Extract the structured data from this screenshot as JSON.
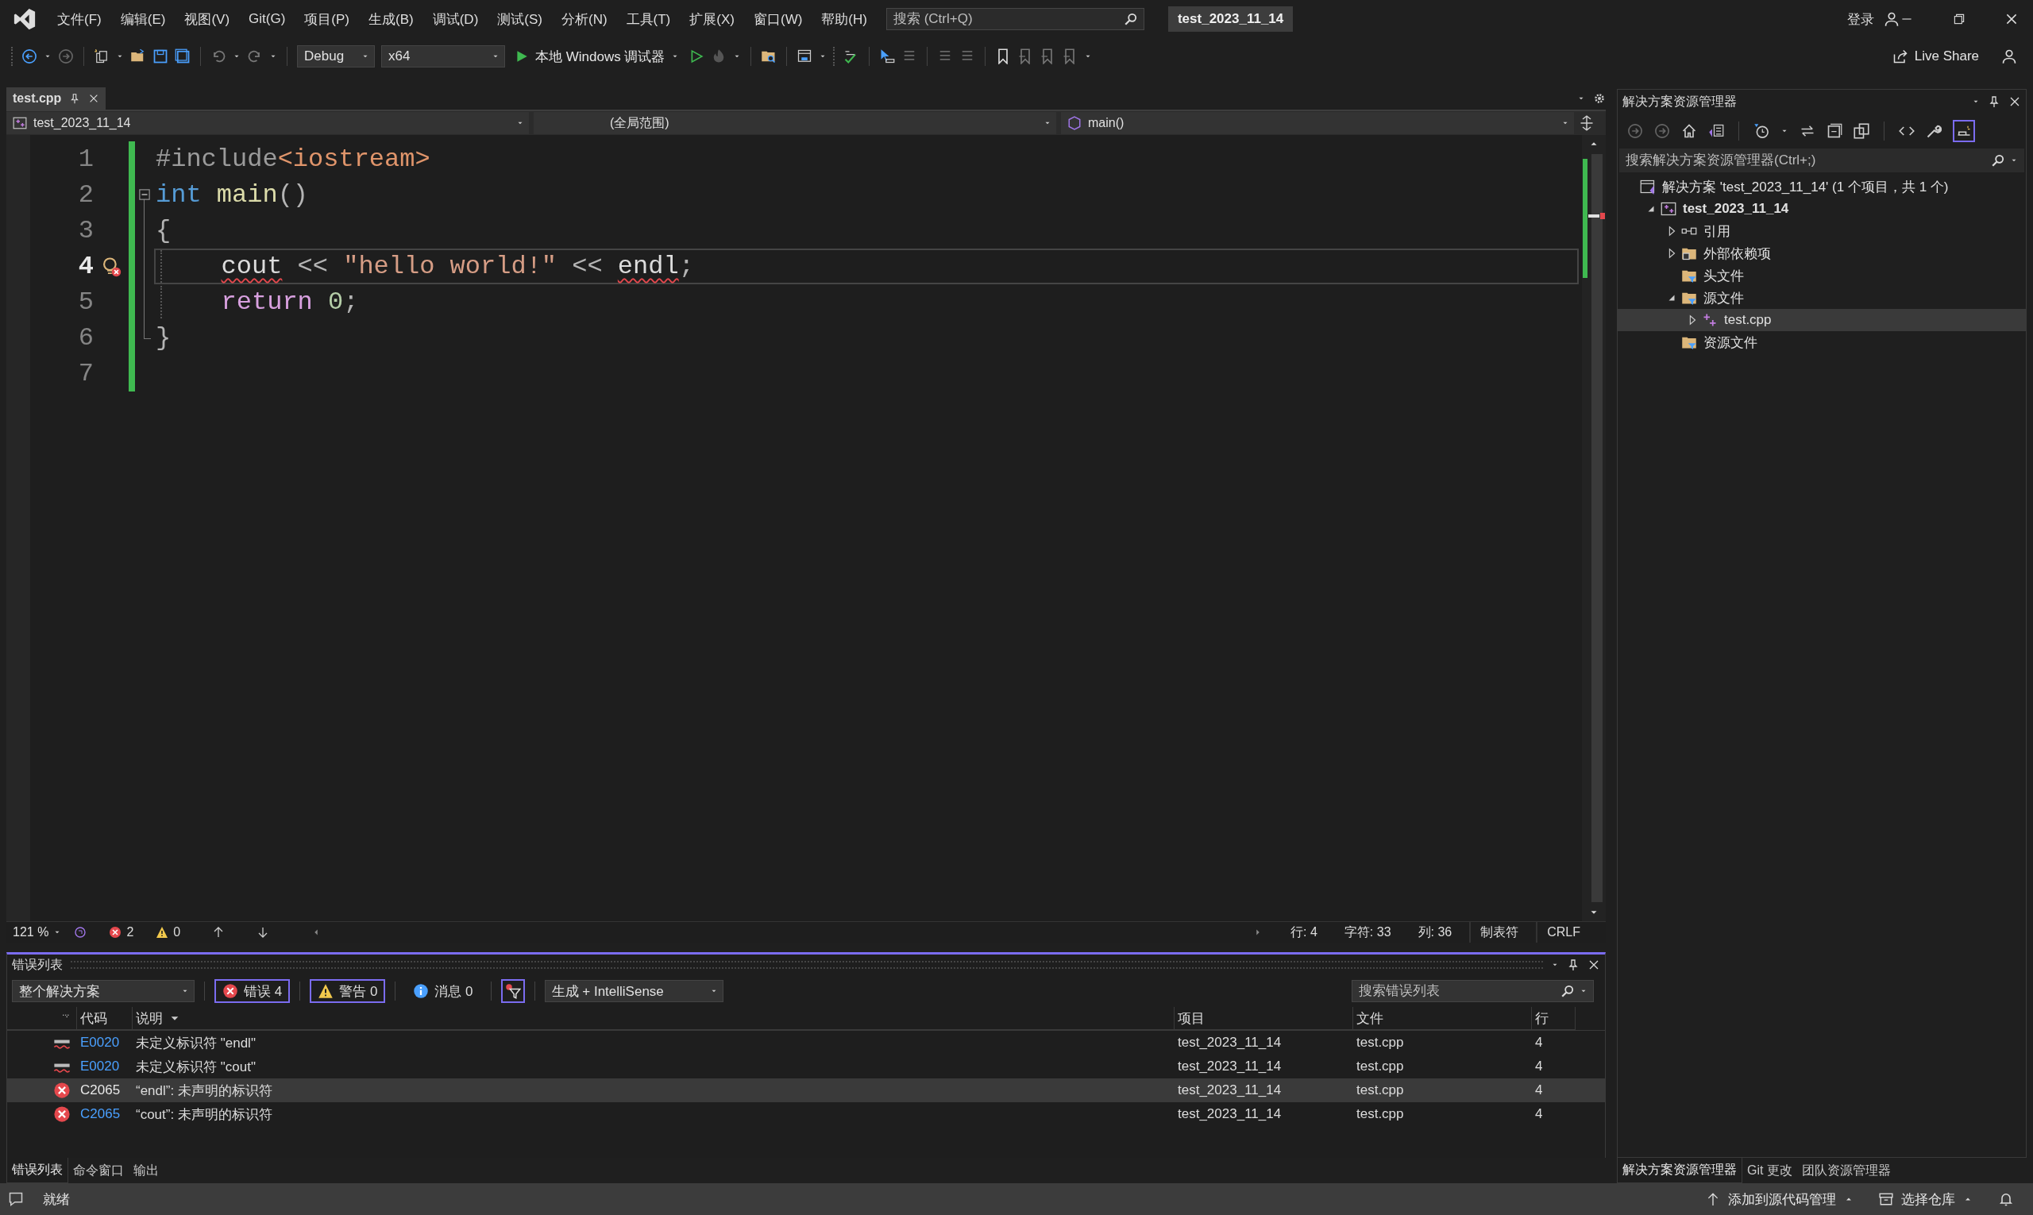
{
  "title_bar": {
    "menu": [
      "文件(F)",
      "编辑(E)",
      "视图(V)",
      "Git(G)",
      "项目(P)",
      "生成(B)",
      "调试(D)",
      "测试(S)",
      "分析(N)",
      "工具(T)",
      "扩展(X)",
      "窗口(W)",
      "帮助(H)"
    ],
    "search": {
      "placeholder": "搜索 (Ctrl+Q)"
    },
    "solution_name": "test_2023_11_14",
    "sign_in": "登录"
  },
  "toolbar": {
    "configuration": "Debug",
    "platform": "x64",
    "debugger": "本地 Windows 调试器",
    "live_share": "Live Share"
  },
  "editor": {
    "tabs": [
      {
        "label": "test.cpp",
        "selected": true
      }
    ],
    "navigation": [
      "test_2023_11_14",
      "(全局范围)",
      "main()"
    ],
    "lines": [
      {
        "number": "1",
        "current": false,
        "indented": false,
        "collapsible": false,
        "in_block": false,
        "error_marker": false,
        "tokens": [
          {
            "kind": "preprocessor",
            "text": "#include",
            "squiggle": false
          },
          {
            "kind": "header",
            "text": "<iostream>",
            "squiggle": false
          }
        ]
      },
      {
        "number": "2",
        "current": false,
        "indented": false,
        "collapsible": true,
        "in_block": false,
        "error_marker": false,
        "tokens": [
          {
            "kind": "keyword",
            "text": "int",
            "squiggle": false
          },
          {
            "kind": "function",
            "text": " main",
            "squiggle": false
          },
          {
            "kind": "punct",
            "text": "()",
            "squiggle": false
          }
        ]
      },
      {
        "number": "3",
        "current": false,
        "indented": false,
        "collapsible": false,
        "in_block": true,
        "error_marker": false,
        "tokens": [
          {
            "kind": "punct",
            "text": "{",
            "squiggle": false
          }
        ]
      },
      {
        "number": "4",
        "current": true,
        "indented": true,
        "collapsible": false,
        "in_block": true,
        "error_marker": true,
        "tokens": [
          {
            "kind": "identifier",
            "text": "cout",
            "squiggle": true
          },
          {
            "kind": "punct",
            "text": " << ",
            "squiggle": false
          },
          {
            "kind": "string",
            "text": "\"hello world!\"",
            "squiggle": false
          },
          {
            "kind": "punct",
            "text": " << ",
            "squiggle": false
          },
          {
            "kind": "identifier",
            "text": "endl",
            "squiggle": true
          },
          {
            "kind": "punct",
            "text": ";",
            "squiggle": false
          }
        ]
      },
      {
        "number": "5",
        "current": false,
        "indented": true,
        "collapsible": false,
        "in_block": true,
        "error_marker": false,
        "tokens": [
          {
            "kind": "control",
            "text": "return",
            "squiggle": false
          },
          {
            "kind": "number",
            "text": " 0",
            "squiggle": false
          },
          {
            "kind": "punct",
            "text": ";",
            "squiggle": false
          }
        ]
      },
      {
        "number": "6",
        "current": false,
        "indented": false,
        "collapsible": false,
        "in_block": true,
        "error_marker": false,
        "tokens": [
          {
            "kind": "punct",
            "text": "}",
            "squiggle": false
          }
        ]
      },
      {
        "number": "7",
        "current": false,
        "indented": false,
        "collapsible": false,
        "in_block": false,
        "error_marker": false
      }
    ],
    "status": {
      "zoom": "121 %",
      "errors": "2",
      "warnings": "0",
      "line": "行: 4",
      "char": "字符: 33",
      "column": "列: 36",
      "indent": "制表符",
      "line_ending": "CRLF"
    }
  },
  "error_list": {
    "title": "错误列表",
    "scope": "整个解决方案",
    "filters": [
      {
        "kind": "error",
        "label": "错误 4",
        "selected": true
      },
      {
        "kind": "warning",
        "label": "警告 0",
        "selected": true
      },
      {
        "kind": "message",
        "label": "消息 0",
        "selected": false
      }
    ],
    "source": "生成 + IntelliSense",
    "search": {
      "placeholder": "搜索错误列表"
    },
    "columns": [
      "代码",
      "说明",
      "项目",
      "文件",
      "行"
    ],
    "rows": [
      {
        "kind": "intellisense",
        "code": "E0020",
        "description": "未定义标识符 \"endl\"",
        "project": "test_2023_11_14",
        "file": "test.cpp",
        "line": "4",
        "selected": false
      },
      {
        "kind": "intellisense",
        "code": "E0020",
        "description": "未定义标识符 \"cout\"",
        "project": "test_2023_11_14",
        "file": "test.cpp",
        "line": "4",
        "selected": false
      },
      {
        "kind": "error",
        "code": "C2065",
        "description": "“endl”: 未声明的标识符",
        "project": "test_2023_11_14",
        "file": "test.cpp",
        "line": "4",
        "selected": true
      },
      {
        "kind": "error",
        "code": "C2065",
        "description": "“cout”: 未声明的标识符",
        "project": "test_2023_11_14",
        "file": "test.cpp",
        "line": "4",
        "selected": false
      }
    ]
  },
  "bottom_tabs": [
    {
      "label": "错误列表",
      "selected": true
    },
    {
      "label": "命令窗口",
      "selected": false
    },
    {
      "label": "输出",
      "selected": false
    }
  ],
  "solution_explorer": {
    "title": "解决方案资源管理器",
    "search": {
      "placeholder": "搜索解决方案资源管理器(Ctrl+;)"
    },
    "tree": [
      {
        "kind": "solution",
        "label": "解决方案 'test_2023_11_14' (1 个项目，共 1 个)",
        "selected": false,
        "children": [
          {
            "kind": "project",
            "label": "test_2023_11_14",
            "expanded": true,
            "selected": false,
            "children": [
              {
                "kind": "references",
                "label": "引用",
                "expanded": false,
                "selected": false
              },
              {
                "kind": "external",
                "label": "外部依赖项",
                "expanded": false,
                "selected": false
              },
              {
                "kind": "filter",
                "label": "头文件",
                "selected": false
              },
              {
                "kind": "filter",
                "label": "源文件",
                "expanded": true,
                "selected": false,
                "children": [
                  {
                    "kind": "cpp",
                    "label": "test.cpp",
                    "expanded": false,
                    "selected": true
                  }
                ]
              },
              {
                "kind": "filter",
                "label": "资源文件",
                "selected": false
              }
            ]
          }
        ]
      }
    ]
  },
  "side_tabs": [
    {
      "label": "解决方案资源管理器",
      "selected": true
    },
    {
      "label": "Git 更改",
      "selected": false
    },
    {
      "label": "团队资源管理器",
      "selected": false
    }
  ],
  "status_bar": {
    "state": "就绪",
    "source_control": "添加到源代码管理",
    "repository": "选择仓库"
  }
}
